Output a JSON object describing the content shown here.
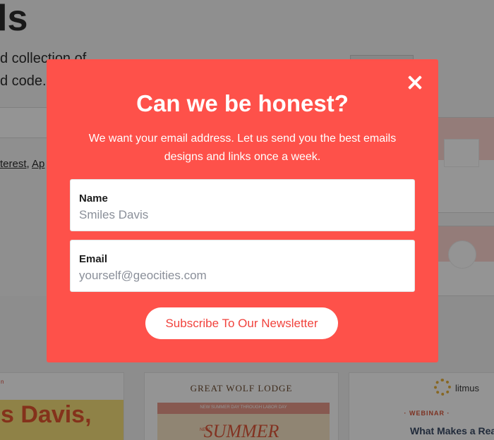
{
  "background": {
    "heading": "ls",
    "sub_line1": "d collection of",
    "sub_line2": "d code.",
    "links": {
      "link1": "terest",
      "separator": ", ",
      "link2": "Ap"
    },
    "cards": {
      "card1": {
        "tag": "n",
        "big_text": "s Davis,"
      },
      "card2": {
        "brand": "GREAT WOLF LODGE",
        "banner": "NEW SUMMER DAY THROUGH LABOR DAY",
        "new_tag": "NEW",
        "headline": "SUMMER"
      },
      "card3": {
        "logo_text": "litmus",
        "label": "· WEBINAR ·",
        "headline": "What Makes a Rea"
      }
    }
  },
  "modal": {
    "title": "Can we be honest?",
    "description": "We want your email address. Let us send you the best emails designs and links once a week.",
    "name_field": {
      "label": "Name",
      "placeholder": "Smiles Davis"
    },
    "email_field": {
      "label": "Email",
      "placeholder": "yourself@geocities.com"
    },
    "subscribe_label": "Subscribe To Our Newsletter",
    "close_icon": "close-icon"
  },
  "colors": {
    "modal_background": "#fe514a",
    "button_text": "#f1433d",
    "overlay": "rgba(0,0,0,0.42)"
  }
}
